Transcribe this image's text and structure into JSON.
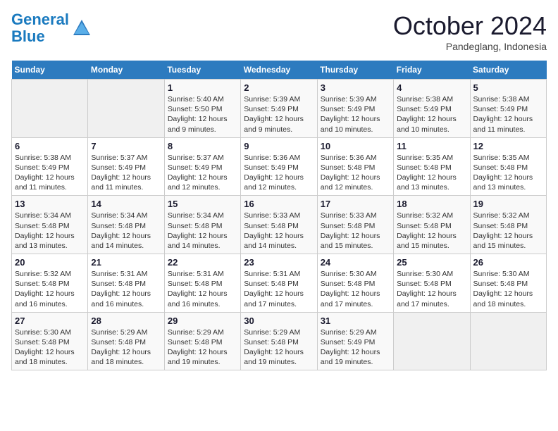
{
  "logo": {
    "line1": "General",
    "line2": "Blue"
  },
  "title": "October 2024",
  "subtitle": "Pandeglang, Indonesia",
  "days_of_week": [
    "Sunday",
    "Monday",
    "Tuesday",
    "Wednesday",
    "Thursday",
    "Friday",
    "Saturday"
  ],
  "weeks": [
    [
      {
        "day": "",
        "info": ""
      },
      {
        "day": "",
        "info": ""
      },
      {
        "day": "1",
        "info": "Sunrise: 5:40 AM\nSunset: 5:50 PM\nDaylight: 12 hours and 9 minutes."
      },
      {
        "day": "2",
        "info": "Sunrise: 5:39 AM\nSunset: 5:49 PM\nDaylight: 12 hours and 9 minutes."
      },
      {
        "day": "3",
        "info": "Sunrise: 5:39 AM\nSunset: 5:49 PM\nDaylight: 12 hours and 10 minutes."
      },
      {
        "day": "4",
        "info": "Sunrise: 5:38 AM\nSunset: 5:49 PM\nDaylight: 12 hours and 10 minutes."
      },
      {
        "day": "5",
        "info": "Sunrise: 5:38 AM\nSunset: 5:49 PM\nDaylight: 12 hours and 11 minutes."
      }
    ],
    [
      {
        "day": "6",
        "info": "Sunrise: 5:38 AM\nSunset: 5:49 PM\nDaylight: 12 hours and 11 minutes."
      },
      {
        "day": "7",
        "info": "Sunrise: 5:37 AM\nSunset: 5:49 PM\nDaylight: 12 hours and 11 minutes."
      },
      {
        "day": "8",
        "info": "Sunrise: 5:37 AM\nSunset: 5:49 PM\nDaylight: 12 hours and 12 minutes."
      },
      {
        "day": "9",
        "info": "Sunrise: 5:36 AM\nSunset: 5:49 PM\nDaylight: 12 hours and 12 minutes."
      },
      {
        "day": "10",
        "info": "Sunrise: 5:36 AM\nSunset: 5:48 PM\nDaylight: 12 hours and 12 minutes."
      },
      {
        "day": "11",
        "info": "Sunrise: 5:35 AM\nSunset: 5:48 PM\nDaylight: 12 hours and 13 minutes."
      },
      {
        "day": "12",
        "info": "Sunrise: 5:35 AM\nSunset: 5:48 PM\nDaylight: 12 hours and 13 minutes."
      }
    ],
    [
      {
        "day": "13",
        "info": "Sunrise: 5:34 AM\nSunset: 5:48 PM\nDaylight: 12 hours and 13 minutes."
      },
      {
        "day": "14",
        "info": "Sunrise: 5:34 AM\nSunset: 5:48 PM\nDaylight: 12 hours and 14 minutes."
      },
      {
        "day": "15",
        "info": "Sunrise: 5:34 AM\nSunset: 5:48 PM\nDaylight: 12 hours and 14 minutes."
      },
      {
        "day": "16",
        "info": "Sunrise: 5:33 AM\nSunset: 5:48 PM\nDaylight: 12 hours and 14 minutes."
      },
      {
        "day": "17",
        "info": "Sunrise: 5:33 AM\nSunset: 5:48 PM\nDaylight: 12 hours and 15 minutes."
      },
      {
        "day": "18",
        "info": "Sunrise: 5:32 AM\nSunset: 5:48 PM\nDaylight: 12 hours and 15 minutes."
      },
      {
        "day": "19",
        "info": "Sunrise: 5:32 AM\nSunset: 5:48 PM\nDaylight: 12 hours and 15 minutes."
      }
    ],
    [
      {
        "day": "20",
        "info": "Sunrise: 5:32 AM\nSunset: 5:48 PM\nDaylight: 12 hours and 16 minutes."
      },
      {
        "day": "21",
        "info": "Sunrise: 5:31 AM\nSunset: 5:48 PM\nDaylight: 12 hours and 16 minutes."
      },
      {
        "day": "22",
        "info": "Sunrise: 5:31 AM\nSunset: 5:48 PM\nDaylight: 12 hours and 16 minutes."
      },
      {
        "day": "23",
        "info": "Sunrise: 5:31 AM\nSunset: 5:48 PM\nDaylight: 12 hours and 17 minutes."
      },
      {
        "day": "24",
        "info": "Sunrise: 5:30 AM\nSunset: 5:48 PM\nDaylight: 12 hours and 17 minutes."
      },
      {
        "day": "25",
        "info": "Sunrise: 5:30 AM\nSunset: 5:48 PM\nDaylight: 12 hours and 17 minutes."
      },
      {
        "day": "26",
        "info": "Sunrise: 5:30 AM\nSunset: 5:48 PM\nDaylight: 12 hours and 18 minutes."
      }
    ],
    [
      {
        "day": "27",
        "info": "Sunrise: 5:30 AM\nSunset: 5:48 PM\nDaylight: 12 hours and 18 minutes."
      },
      {
        "day": "28",
        "info": "Sunrise: 5:29 AM\nSunset: 5:48 PM\nDaylight: 12 hours and 18 minutes."
      },
      {
        "day": "29",
        "info": "Sunrise: 5:29 AM\nSunset: 5:48 PM\nDaylight: 12 hours and 19 minutes."
      },
      {
        "day": "30",
        "info": "Sunrise: 5:29 AM\nSunset: 5:48 PM\nDaylight: 12 hours and 19 minutes."
      },
      {
        "day": "31",
        "info": "Sunrise: 5:29 AM\nSunset: 5:49 PM\nDaylight: 12 hours and 19 minutes."
      },
      {
        "day": "",
        "info": ""
      },
      {
        "day": "",
        "info": ""
      }
    ]
  ]
}
